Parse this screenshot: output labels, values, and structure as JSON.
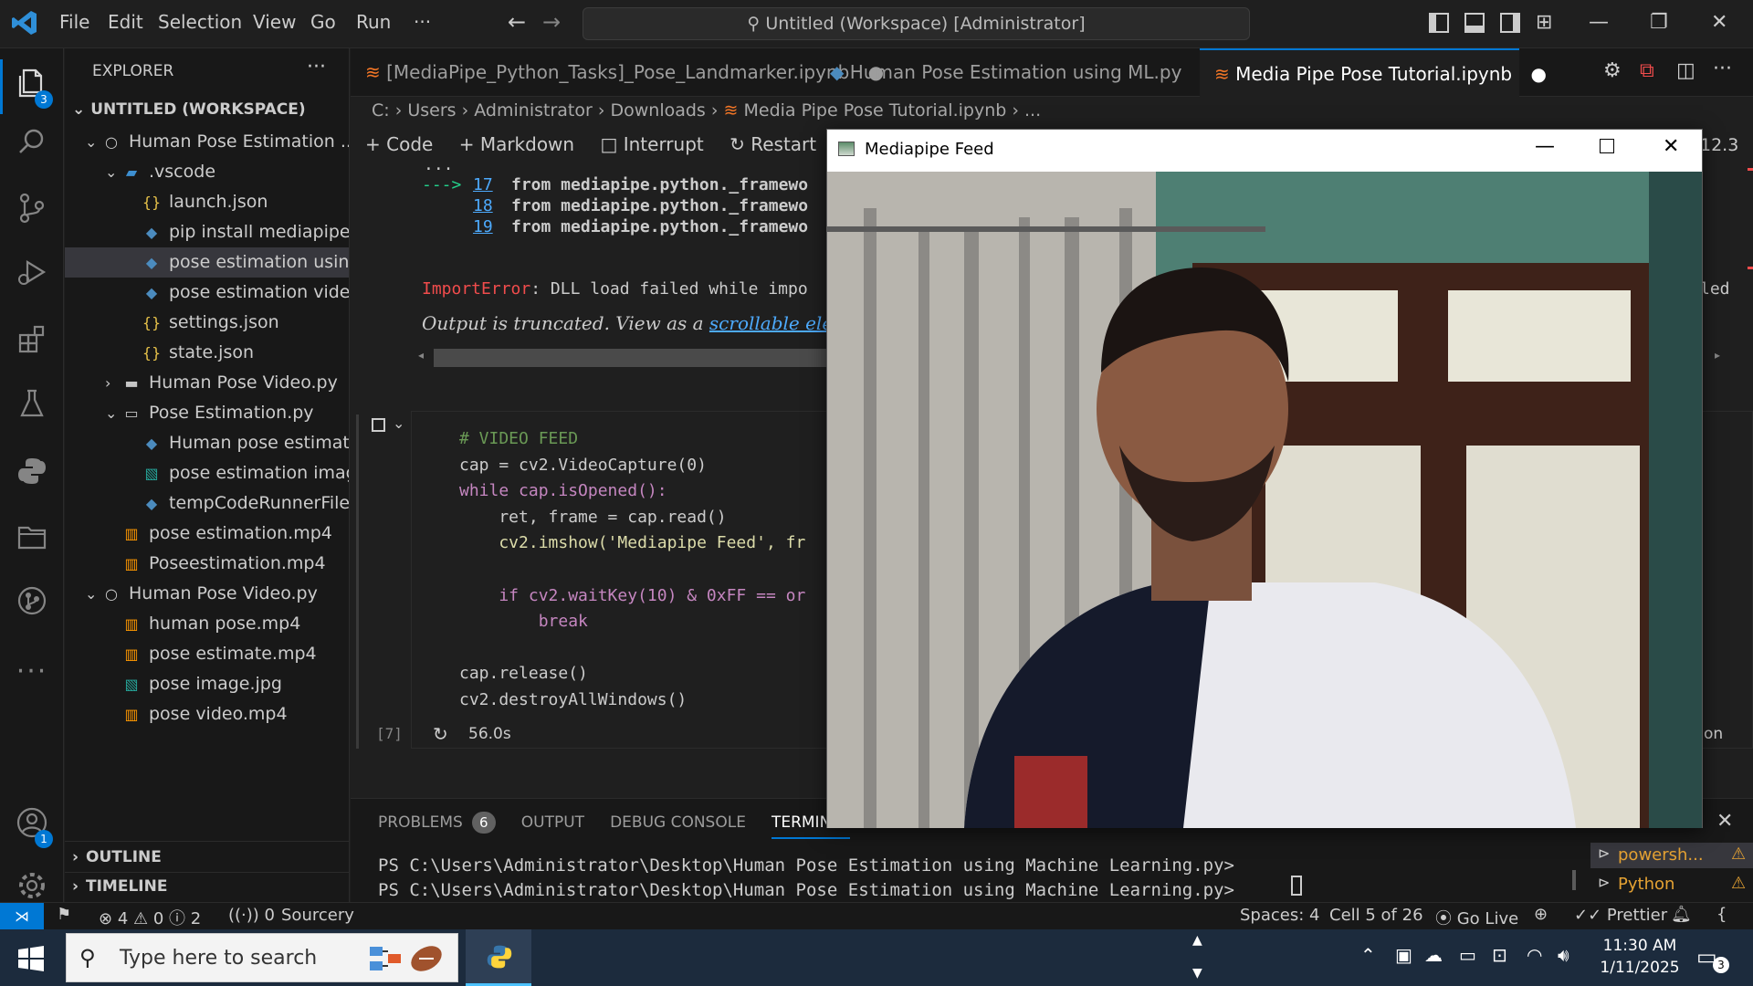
{
  "menu": {
    "items": [
      "File",
      "Edit",
      "Selection",
      "View",
      "Go",
      "Run",
      "···"
    ],
    "command_center": "Untitled (Workspace) [Administrator]"
  },
  "activity": {
    "explorer_badge": "3",
    "account_badge": "1"
  },
  "explorer": {
    "title": "EXPLORER",
    "workspace": "UNTITLED (WORKSPACE)",
    "items": [
      {
        "label": "Human Pose Estimation ...",
        "icon": "circle-icon",
        "indent": 0,
        "chevron": "down"
      },
      {
        "label": ".vscode",
        "icon": "folder-vscode-icon",
        "indent": 1,
        "chevron": "down"
      },
      {
        "label": "launch.json",
        "icon": "json-icon",
        "indent": 2,
        "chevron": ""
      },
      {
        "label": "pip install mediapipe ...",
        "icon": "python-icon",
        "indent": 2,
        "chevron": ""
      },
      {
        "label": "pose estimation usin...",
        "icon": "python-icon",
        "indent": 2,
        "chevron": "",
        "selected": true
      },
      {
        "label": "pose estimation vide...",
        "icon": "python-icon",
        "indent": 2,
        "chevron": ""
      },
      {
        "label": "settings.json",
        "icon": "json-icon",
        "indent": 2,
        "chevron": ""
      },
      {
        "label": "state.json",
        "icon": "json-icon",
        "indent": 2,
        "chevron": ""
      },
      {
        "label": "Human Pose Video.py",
        "icon": "folder-icon",
        "indent": 1,
        "chevron": "right"
      },
      {
        "label": "Pose Estimation.py",
        "icon": "folder-open-icon",
        "indent": 1,
        "chevron": "down"
      },
      {
        "label": "Human pose estimati...",
        "icon": "python-icon",
        "indent": 2,
        "chevron": ""
      },
      {
        "label": "pose estimation imag...",
        "icon": "image-icon",
        "indent": 2,
        "chevron": ""
      },
      {
        "label": "tempCodeRunnerFile....",
        "icon": "python-icon",
        "indent": 2,
        "chevron": ""
      },
      {
        "label": "pose estimation.mp4",
        "icon": "video-icon",
        "indent": 1,
        "chevron": ""
      },
      {
        "label": "Poseestimation.mp4",
        "icon": "video-icon",
        "indent": 1,
        "chevron": ""
      },
      {
        "label": "Human Pose Video.py",
        "icon": "circle-icon",
        "indent": 0,
        "chevron": "down"
      },
      {
        "label": "human pose.mp4",
        "icon": "video-icon",
        "indent": 1,
        "chevron": ""
      },
      {
        "label": "pose estimate.mp4",
        "icon": "video-icon",
        "indent": 1,
        "chevron": ""
      },
      {
        "label": "pose image.jpg",
        "icon": "image-icon",
        "indent": 1,
        "chevron": ""
      },
      {
        "label": "pose video.mp4",
        "icon": "video-icon",
        "indent": 1,
        "chevron": ""
      }
    ],
    "outline": "OUTLINE",
    "timeline": "TIMELINE"
  },
  "tabs": [
    {
      "label": "[MediaPipe_Python_Tasks]_Pose_Landmarker.ipynb",
      "icon": "jupyter-icon",
      "active": false
    },
    {
      "label": "Human Pose Estimation using ML.py",
      "icon": "python-icon",
      "active": false
    },
    {
      "label": "Media Pipe Pose Tutorial.ipynb",
      "icon": "jupyter-icon",
      "active": true
    }
  ],
  "breadcrumb": [
    "C:",
    "Users",
    "Administrator",
    "Downloads",
    "Media Pipe Pose Tutorial.ipynb",
    "..."
  ],
  "notebook_toolbar": {
    "code": "Code",
    "markdown": "Markdown",
    "interrupt": "Interrupt",
    "restart": "Restart",
    "kernel_version": "12.3"
  },
  "output": {
    "dots": "...",
    "lines": [
      {
        "arrow": "--->",
        "num": "17",
        "text": "from mediapipe.python._framewo"
      },
      {
        "arrow": "",
        "num": "18",
        "text": "from mediapipe.python._framewo"
      },
      {
        "arrow": "",
        "num": "19",
        "text": "from mediapipe.python._framewo"
      }
    ],
    "error_name": "ImportError",
    "error_text": ": DLL load failed while impo",
    "error_suffix": "led",
    "truncated_text": "Output is truncated. View as a ",
    "truncated_link": "scrollable element"
  },
  "cell": {
    "lines": [
      "# VIDEO FEED",
      "cap = cv2.VideoCapture(0)",
      "while cap.isOpened():",
      "    ret, frame = cap.read()",
      "    cv2.imshow('Mediapipe Feed', fr",
      "",
      "    if cv2.waitKey(10) & 0xFF == or",
      "        break",
      "",
      "cap.release()",
      "cv2.destroyAllWindows()"
    ],
    "exec_count": "[7]",
    "duration": "56.0s",
    "lang_suffix": "on"
  },
  "panel": {
    "tabs": [
      "PROBLEMS",
      "OUTPUT",
      "DEBUG CONSOLE",
      "TERMINAL"
    ],
    "problems_count": "6",
    "terminal_lines": [
      "PS C:\\Users\\Administrator\\Desktop\\Human Pose Estimation using Machine Learning.py>",
      "PS C:\\Users\\Administrator\\Desktop\\Human Pose Estimation using Machine Learning.py>"
    ],
    "terminals": [
      "powersh...",
      "Python"
    ]
  },
  "status": {
    "errors": "4",
    "warnings": "0",
    "infos": "2",
    "ports": "0",
    "sourcery": "Sourcery",
    "spaces": "Spaces: 4",
    "cell": "Cell 5 of 26",
    "golive": "Go Live",
    "prettier": "Prettier"
  },
  "feed_window": {
    "title": "Mediapipe Feed"
  },
  "taskbar": {
    "search_placeholder": "Type here to search",
    "time": "11:30 AM",
    "date": "1/11/2025",
    "notif_count": "3"
  },
  "colors": {
    "accent": "#0078d4",
    "error": "#f14c4c",
    "link": "#4daafc",
    "keyword": "#c586c0",
    "comment": "#6a9955",
    "string": "#ce9178",
    "number": "#b5cea8",
    "func": "#dcdcaa"
  }
}
